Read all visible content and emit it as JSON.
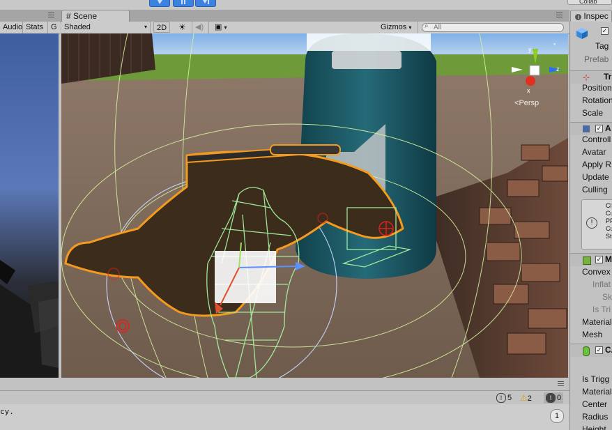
{
  "top": {
    "collab_label": "Collab"
  },
  "game_toolbar": {
    "audio_label": "Audio",
    "stats_label": "Stats",
    "gizmos_label": "G"
  },
  "scene": {
    "tab_label": "Scene",
    "shading_mode": "Shaded",
    "mode_2d_label": "2D",
    "gizmos_label": "Gizmos",
    "search_placeholder": "All",
    "persp_label": "Persp",
    "axis_y": "y",
    "axis_z": "z",
    "axis_x": "x"
  },
  "inspector": {
    "tab_label": "Inspec",
    "tag_label": "Tag",
    "prefab_label": "Prefab",
    "transform": {
      "header": "Tr",
      "rows": [
        "Position",
        "Rotation",
        "Scale"
      ]
    },
    "animator": {
      "header": "A",
      "rows": [
        "Controll",
        "Avatar",
        "Apply R",
        "Update",
        "Culling"
      ],
      "info_lines": [
        "Cl",
        "Cu",
        "PF",
        "Cu",
        "St"
      ]
    },
    "mesh_collider": {
      "header": "M",
      "rows": [
        "Convex",
        "Inflat",
        "Sk",
        "Is Tri",
        "Material",
        "Mesh"
      ]
    },
    "capsule_collider": {
      "header": "CA",
      "rows": [
        "Is Trigg",
        "Material",
        "Center",
        "Radius",
        "Height"
      ]
    }
  },
  "console": {
    "info_count": "5",
    "warning_count": "2",
    "error_count": "0",
    "status_text": "cy.",
    "badge_count": "1"
  },
  "colors": {
    "selection_outline": "#f39a1f",
    "wireframe": "#a6f0a0",
    "play_button": "#3c82e0",
    "ground": "#7a6654",
    "sky": "#8fb8e6",
    "barrel": "#1f5a66"
  }
}
